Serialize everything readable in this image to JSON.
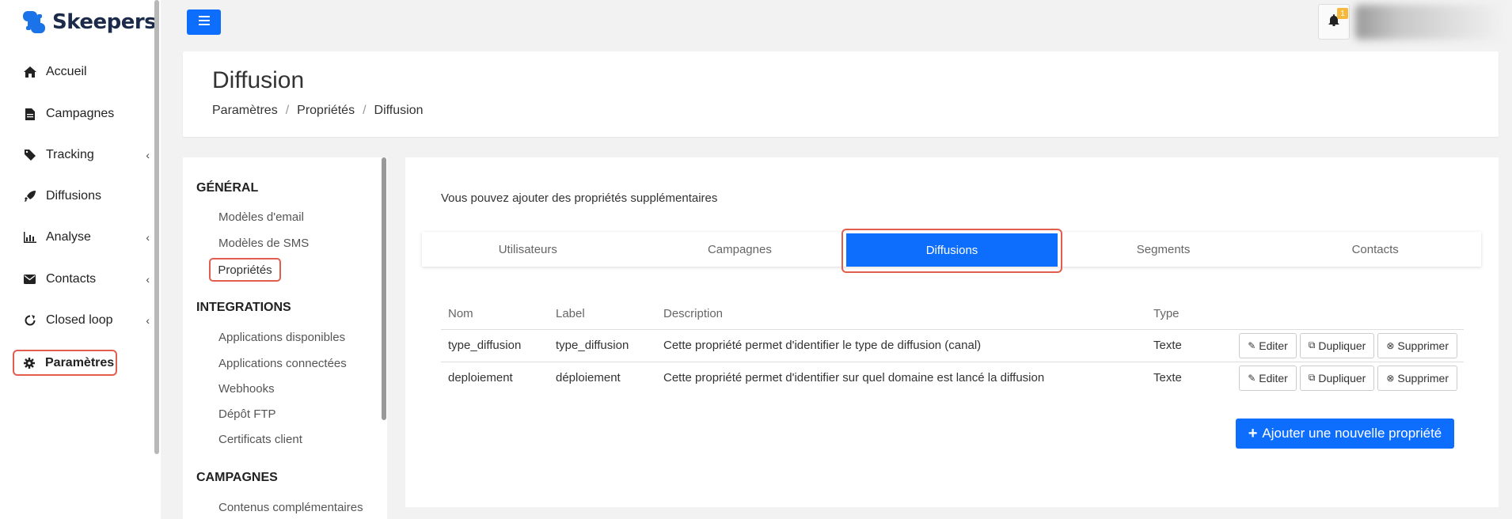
{
  "brand": {
    "name": "Skeepers",
    "color": "#0d6efd"
  },
  "sidebar": {
    "items": [
      {
        "label": "Accueil",
        "icon": "home-icon"
      },
      {
        "label": "Campagnes",
        "icon": "file-icon"
      },
      {
        "label": "Tracking",
        "icon": "tag-icon",
        "has_submenu": true
      },
      {
        "label": "Diffusions",
        "icon": "rocket-icon"
      },
      {
        "label": "Analyse",
        "icon": "bar-chart-icon",
        "has_submenu": true
      },
      {
        "label": "Contacts",
        "icon": "envelope-icon",
        "has_submenu": true
      },
      {
        "label": "Closed loop",
        "icon": "refresh-icon",
        "has_submenu": true
      },
      {
        "label": "Paramètres",
        "icon": "gear-icon",
        "active": true
      }
    ]
  },
  "topbar": {
    "notification_count": "1"
  },
  "header": {
    "title": "Diffusion",
    "breadcrumb": [
      "Paramètres",
      "Propriétés",
      "Diffusion"
    ]
  },
  "settings_nav": {
    "sections": [
      {
        "title": "GÉNÉRAL",
        "links": [
          "Modèles d'email",
          "Modèles de SMS",
          "Propriétés"
        ]
      },
      {
        "title": "INTEGRATIONS",
        "links": [
          "Applications disponibles",
          "Applications connectées",
          "Webhooks",
          "Dépôt FTP",
          "Certificats client"
        ]
      },
      {
        "title": "CAMPAGNES",
        "links": [
          "Contenus complémentaires"
        ]
      }
    ],
    "active_link": "Propriétés"
  },
  "content": {
    "intro": "Vous pouvez ajouter des propriétés supplémentaires",
    "tabs": [
      "Utilisateurs",
      "Campagnes",
      "Diffusions",
      "Segments",
      "Contacts"
    ],
    "active_tab": "Diffusions",
    "table": {
      "headers": [
        "Nom",
        "Label",
        "Description",
        "Type"
      ],
      "rows": [
        {
          "nom": "type_diffusion",
          "label": "type_diffusion",
          "description": "Cette propriété permet d'identifier le type de diffusion (canal)",
          "type": "Texte"
        },
        {
          "nom": "deploiement",
          "label": "déploiement",
          "description": "Cette propriété permet d'identifier sur quel domaine est lancé la diffusion",
          "type": "Texte"
        }
      ],
      "actions": {
        "edit": "Editer",
        "duplicate": "Dupliquer",
        "delete": "Supprimer"
      }
    },
    "add_button": "Ajouter une nouvelle propriété"
  }
}
